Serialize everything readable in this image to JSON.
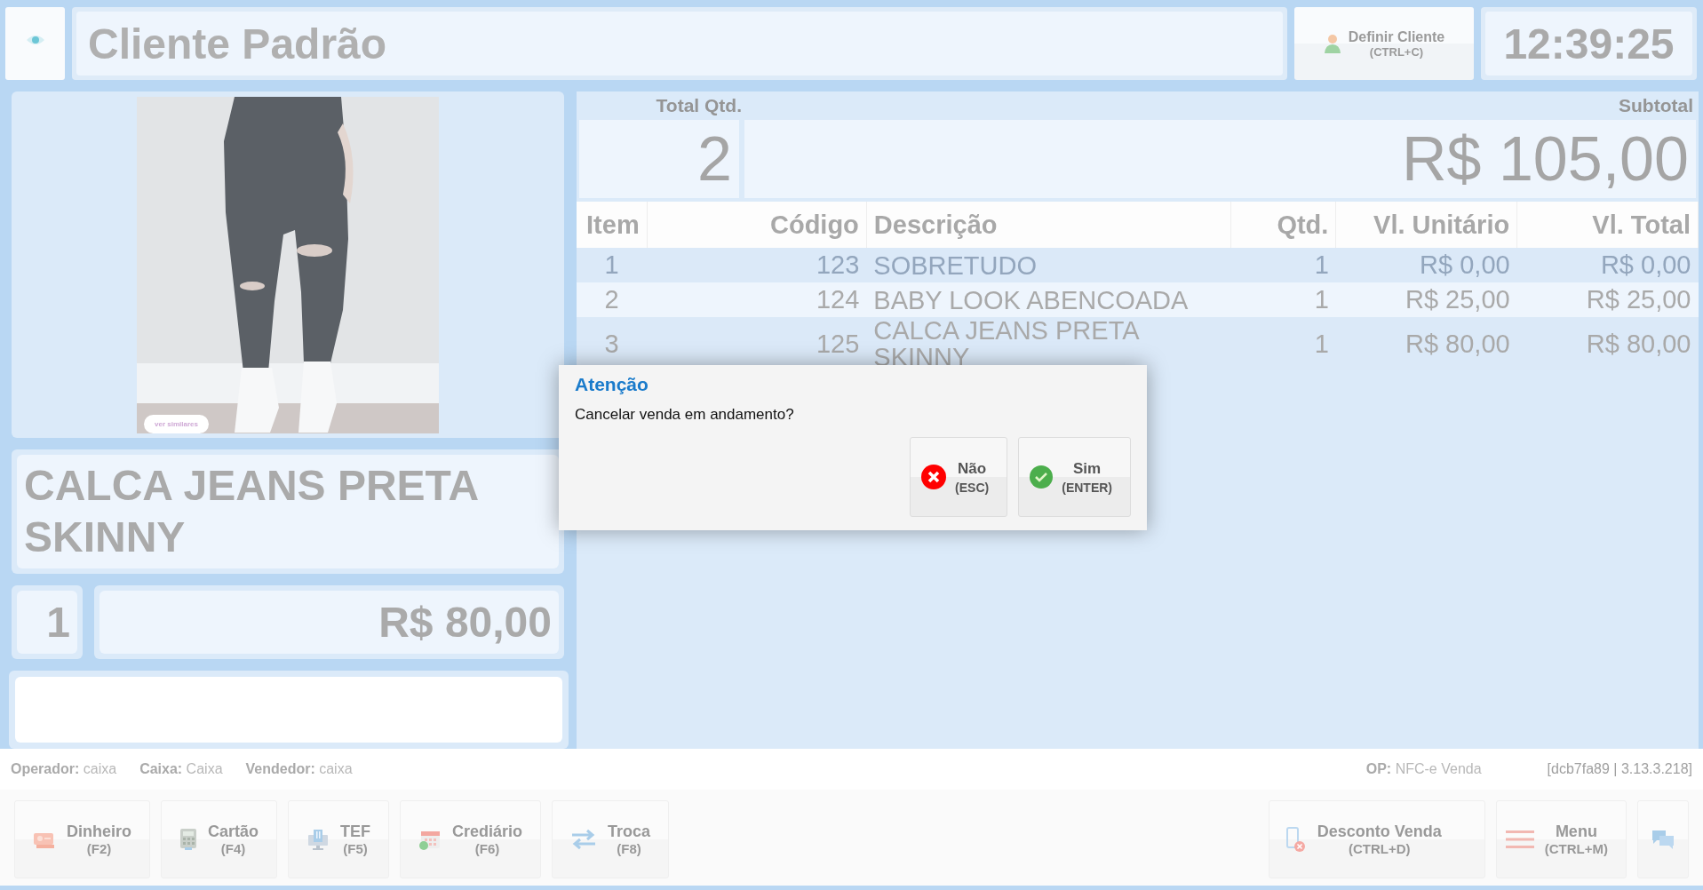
{
  "header": {
    "client_name": "Cliente Padrão",
    "define_client_button": {
      "label": "Definir Cliente",
      "shortcut": "(CTRL+C)"
    },
    "clock": "12:39:25"
  },
  "product": {
    "similar_button": "ver similares",
    "name": "CALCA JEANS PRETA SKINNY",
    "quantity": "1",
    "price": "R$ 80,00"
  },
  "totals": {
    "quantity_label": "Total Qtd.",
    "subtotal_label": "Subtotal",
    "quantity": "2",
    "subtotal": "R$ 105,00"
  },
  "table": {
    "columns": [
      "Item",
      "Código",
      "Descrição",
      "Qtd.",
      "Vl. Unitário",
      "Vl. Total"
    ],
    "rows": [
      {
        "cancelled": true,
        "cells": [
          "1",
          "123",
          "SOBRETUDO",
          "1",
          "R$ 0,00",
          "R$ 0,00"
        ]
      },
      {
        "cancelled": false,
        "cells": [
          "2",
          "124",
          "BABY LOOK ABENCOADA",
          "1",
          "R$ 25,00",
          "R$ 25,00"
        ]
      },
      {
        "cancelled": false,
        "cells": [
          "3",
          "125",
          "CALCA JEANS PRETA SKINNY",
          "1",
          "R$ 80,00",
          "R$ 80,00"
        ]
      }
    ]
  },
  "dialog": {
    "title": "Atenção",
    "message": "Cancelar venda em andamento?",
    "buttons": [
      {
        "kind": "cancel",
        "label": "Não",
        "shortcut": "(ESC)"
      },
      {
        "kind": "confirm",
        "label": "Sim",
        "shortcut": "(ENTER)"
      }
    ]
  },
  "status_bar": {
    "fields": [
      "**Operador:** caixa",
      "**Caixa:** Caixa",
      "**Vendedor:** caixa"
    ],
    "operation": "**OP:** NFC-e Venda",
    "version": "[dcb7fa89 | 3.13.3.218]"
  },
  "footer": {
    "left_buttons": [
      {
        "label": "Dinheiro",
        "shortcut": "(F2)"
      },
      {
        "label": "Cartão",
        "shortcut": "(F4)"
      },
      {
        "label": "TEF",
        "shortcut": "(F5)"
      },
      {
        "label": "Crediário",
        "shortcut": "(F6)"
      },
      {
        "label": "Troca",
        "shortcut": "(F8)"
      }
    ],
    "right_buttons": [
      {
        "label": "Desconto Venda",
        "shortcut": "(CTRL+D)"
      },
      {
        "label": "Menu",
        "shortcut": "(CTRL+M)"
      }
    ]
  }
}
